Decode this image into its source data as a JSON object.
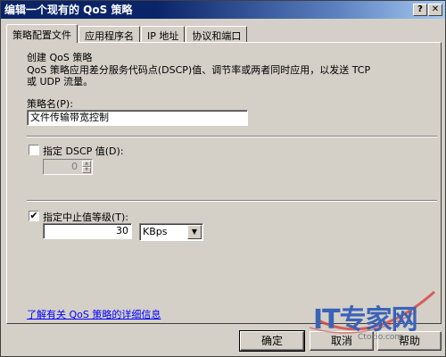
{
  "window": {
    "title": "编辑一个现有的 QoS 策略",
    "help_label": "?",
    "close_label": "✕"
  },
  "tabs": [
    {
      "label": "策略配置文件",
      "active": true
    },
    {
      "label": "应用程序名",
      "active": false
    },
    {
      "label": "IP 地址",
      "active": false
    },
    {
      "label": "协议和端口",
      "active": false
    }
  ],
  "profile": {
    "heading": "创建 QoS 策略",
    "description_line1": "QoS 策略应用差分服务代码点(DSCP)值、调节率或两者同时应用，以发送 TCP",
    "description_line2": "或 UDP 流量。",
    "policy_name_label": "策略名(P):",
    "policy_name_value": "文件传输带宽控制"
  },
  "dscp": {
    "checkbox_label": "指定 DSCP 值(D):",
    "checked": false,
    "value": "0"
  },
  "throttle": {
    "checkbox_label": "指定中止值等级(T):",
    "checked": true,
    "value": "30",
    "unit": "KBps"
  },
  "footer": {
    "link_text": "了解有关 QoS 策略的详细信息"
  },
  "buttons": {
    "ok": "确定",
    "cancel": "取消",
    "help": "帮助"
  },
  "watermark": {
    "brand": "IT专家网",
    "domain": "Ctocio.com"
  }
}
